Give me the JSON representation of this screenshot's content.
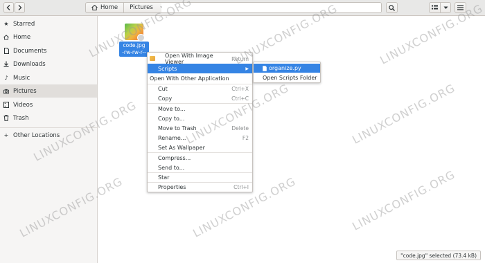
{
  "header": {
    "nav_back_icon": "chevron-left-icon",
    "nav_forward_icon": "chevron-right-icon",
    "breadcrumbs": [
      {
        "label": "Home",
        "icon": "home-icon"
      },
      {
        "label": "Pictures"
      }
    ],
    "search_icon": "search-icon",
    "view_mode_icon": "list-view-icon",
    "view_options_icon": "chevron-down-icon",
    "menu_icon": "hamburger-icon"
  },
  "sidebar": {
    "items": [
      {
        "label": "Starred",
        "icon": "star-icon"
      },
      {
        "label": "Home",
        "icon": "home-icon"
      },
      {
        "label": "Documents",
        "icon": "document-icon"
      },
      {
        "label": "Downloads",
        "icon": "download-icon"
      },
      {
        "label": "Music",
        "icon": "music-icon"
      },
      {
        "label": "Pictures",
        "icon": "camera-icon",
        "active": true
      },
      {
        "label": "Videos",
        "icon": "video-icon"
      },
      {
        "label": "Trash",
        "icon": "trash-icon"
      },
      {
        "label": "Other Locations",
        "icon": "plus-icon"
      }
    ]
  },
  "file": {
    "name": "code.jpg",
    "permissions": "-rw-rw-r--"
  },
  "context_menu": {
    "items": [
      {
        "label": "Open With Image Viewer",
        "accel": "Return"
      },
      {
        "label": "Scripts",
        "submenu": true
      },
      {
        "label": "Open With Other Application",
        "accel": ""
      },
      {
        "label": "Cut",
        "accel": "Ctrl+X"
      },
      {
        "label": "Copy",
        "accel": "Ctrl+C"
      },
      {
        "label": "Move to...",
        "accel": ""
      },
      {
        "label": "Copy to...",
        "accel": ""
      },
      {
        "label": "Move to Trash",
        "accel": "Delete"
      },
      {
        "label": "Rename...",
        "accel": "F2"
      },
      {
        "label": "Set As Wallpaper",
        "accel": ""
      },
      {
        "label": "Compress...",
        "accel": ""
      },
      {
        "label": "Send to...",
        "accel": ""
      },
      {
        "label": "Star",
        "accel": ""
      },
      {
        "label": "Properties",
        "accel": "Ctrl+I"
      }
    ]
  },
  "scripts_submenu": {
    "items": [
      {
        "label": "organize.py",
        "icon": "script-file-icon"
      },
      {
        "label": "Open Scripts Folder"
      }
    ]
  },
  "status_bar": {
    "text": "\"code.jpg\" selected (73.4 kB)"
  },
  "watermark": {
    "text": "LINUXCONFIG.ORG"
  },
  "colors": {
    "accent": "#3584e4",
    "sidebar_bg": "#f6f5f4",
    "header_bg": "#e8e8e7"
  }
}
